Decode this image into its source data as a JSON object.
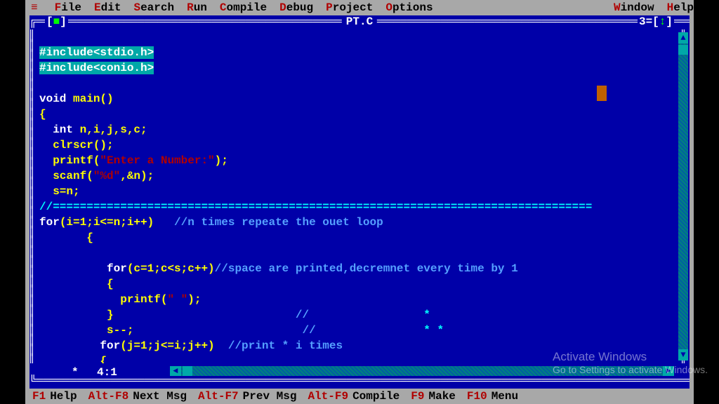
{
  "menu": {
    "corner": "≡",
    "items": [
      {
        "hk": "F",
        "rest": "ile"
      },
      {
        "hk": "E",
        "rest": "dit"
      },
      {
        "hk": "S",
        "rest": "earch"
      },
      {
        "hk": "R",
        "rest": "un"
      },
      {
        "hk": "C",
        "rest": "ompile"
      },
      {
        "hk": "D",
        "rest": "ebug"
      },
      {
        "hk": "P",
        "rest": "roject"
      },
      {
        "hk": "O",
        "rest": "ptions"
      }
    ],
    "right": [
      {
        "hk": "W",
        "rest": "indow"
      },
      {
        "hk": "H",
        "rest": "elp"
      }
    ]
  },
  "window": {
    "title": " PT.C ",
    "number_prefix": "3=[",
    "number_arrow": "↕",
    "number_suffix": "]",
    "close_l": "[",
    "close_sq": "■",
    "close_r": "]",
    "cursor_pos": "4:1",
    "modified": "*"
  },
  "code": {
    "l1a": "#include",
    "l1b": "<stdio.h>",
    "l2a": "#include",
    "l2b": "<conio.h>",
    "l3": "",
    "l4a": "void",
    "l4b": " main()",
    "l5": "{",
    "l6a": "  int",
    "l6b": " n,i,j,s,c;",
    "l7": "  clrscr();",
    "l8a": "  printf(",
    "l8b": "\"Enter a Number:\"",
    "l8c": ");",
    "l9a": "  scanf(",
    "l9b": "\"%d\"",
    "l9c": ",&n);",
    "l10": "  s=n;",
    "l11": "//================================================================================",
    "l12a": "for",
    "l12b": "(i=1;i<=n;i++)   ",
    "l12c": "//n times repeate the ouet loop",
    "l13": "       {",
    "l14": "",
    "l15a": "          for",
    "l15b": "(c=1;c<s;c++)",
    "l15c": "//space are printed,decremnet every time by 1",
    "l16": "          {",
    "l17a": "            printf(",
    "l17b": "\" \"",
    "l17c": ");",
    "l18a": "          }                           ",
    "l18b": "//",
    "l18c": "                 *",
    "l19a": "          s--;                         ",
    "l19b": "//",
    "l19c": "                * *",
    "l20a": "         for",
    "l20b": "(j=1;j<=i;j++)  ",
    "l20c": "//print * i times",
    "l21": "         {"
  },
  "status": {
    "items": [
      {
        "key": "F1",
        "label": "Help"
      },
      {
        "key": "Alt-F8",
        "label": "Next Msg"
      },
      {
        "key": "Alt-F7",
        "label": "Prev Msg"
      },
      {
        "key": "Alt-F9",
        "label": "Compile"
      },
      {
        "key": "F9",
        "label": "Make"
      },
      {
        "key": "F10",
        "label": "Menu"
      }
    ]
  },
  "watermark": {
    "title": "Activate Windows",
    "sub": "Go to Settings to activate Windows."
  }
}
